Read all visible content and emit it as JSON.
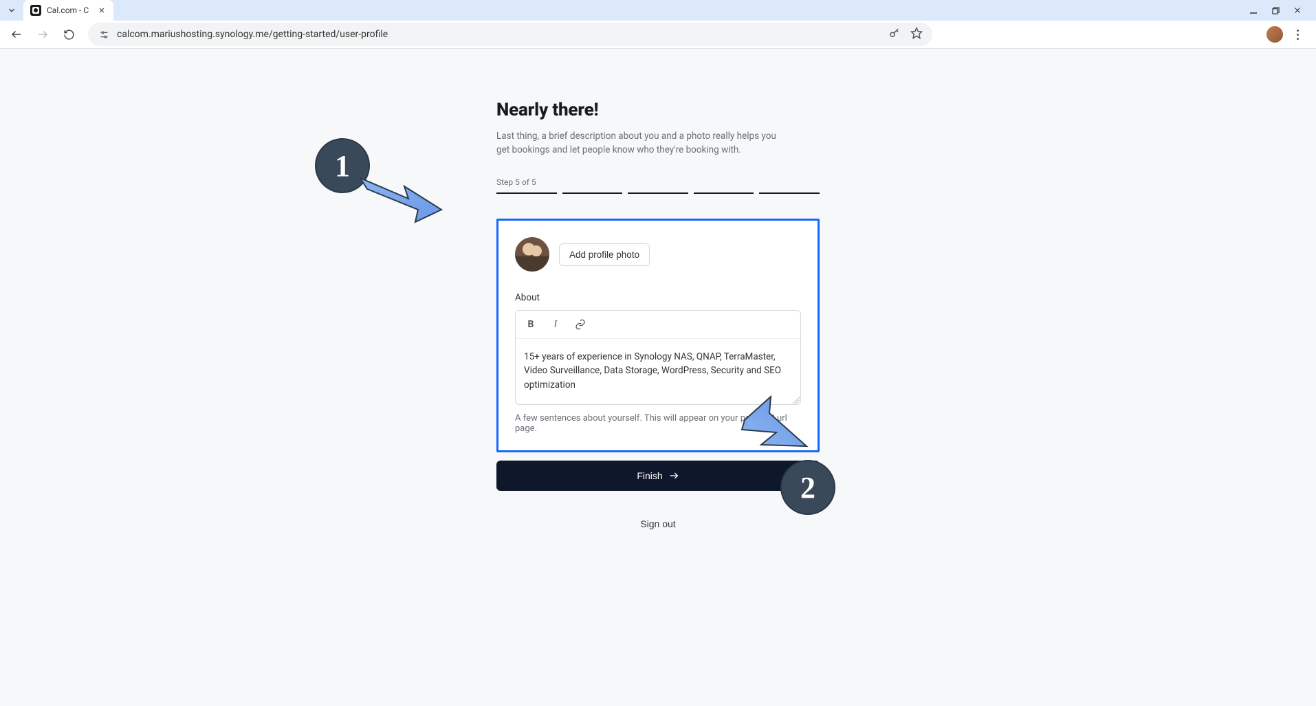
{
  "browser": {
    "tab_title": "Cal.com - C",
    "url": "calcom.mariushosting.synology.me/getting-started/user-profile"
  },
  "page": {
    "title": "Nearly there!",
    "subtitle": "Last thing, a brief description about you and a photo really helps you get bookings and let people know who they're booking with.",
    "step_label": "Step 5 of 5"
  },
  "form": {
    "add_photo_btn": "Add profile photo",
    "about_label": "About",
    "about_value": "15+ years of experience in Synology NAS, QNAP, TerraMaster, Video Surveillance, Data Storage, WordPress, Security and SEO optimization",
    "about_helper": "A few sentences about yourself. This will appear on your personal url page.",
    "submit_label": "Finish",
    "signout_label": "Sign out"
  },
  "annotations": {
    "one": "1",
    "two": "2"
  }
}
